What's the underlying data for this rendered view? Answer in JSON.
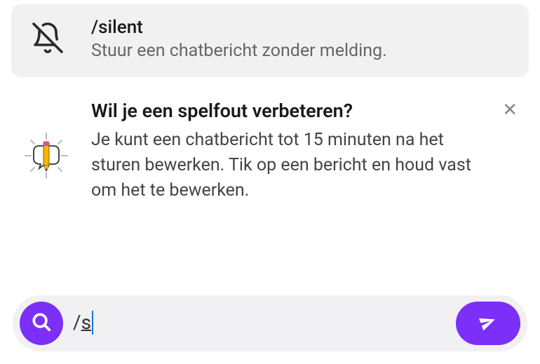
{
  "suggestion": {
    "command": "/silent",
    "description": "Stuur een chatbericht zonder melding."
  },
  "tip": {
    "title": "Wil je een spelfout verbeteren?",
    "body": "Je kunt een chatbericht tot 15 minuten na het sturen bewerken. Tik op een bericht en houd vast om het te bewerken."
  },
  "input": {
    "value": "/s"
  },
  "colors": {
    "accent": "#7b2ff7"
  }
}
